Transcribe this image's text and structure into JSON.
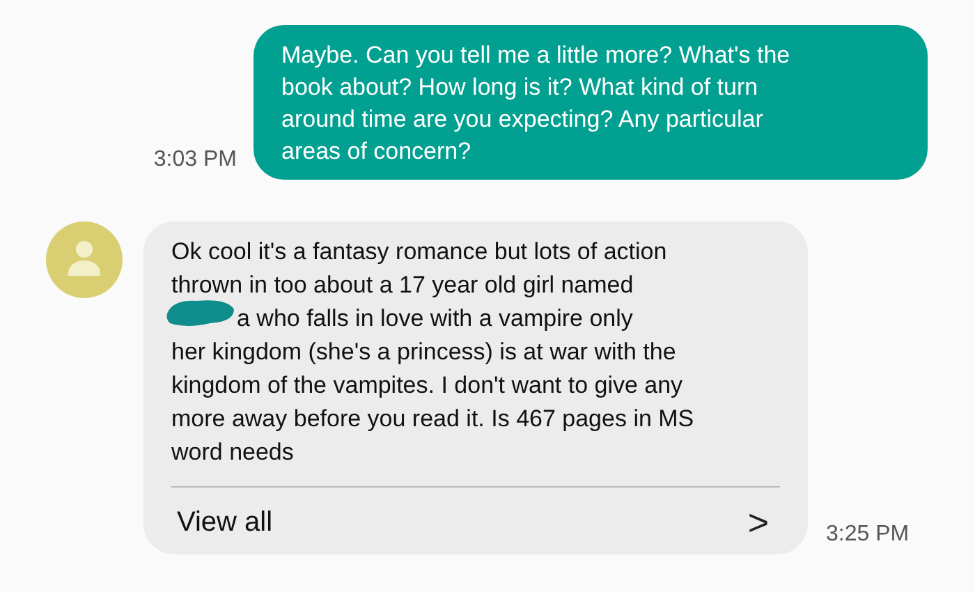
{
  "messages": [
    {
      "kind": "outgoing",
      "lines": [
        "Maybe. Can you tell me a little more? What's the",
        "book about? How long is it? What kind of turn",
        "around time are you expecting? Any particular",
        "areas of concern?"
      ],
      "time": "3:03 PM"
    },
    {
      "kind": "incoming",
      "lines": [
        {
          "text": "Ok cool it's a fantasy romance but lots of action",
          "redacted": false
        },
        {
          "text": "thrown in too about a 17 year old girl named",
          "redacted": false
        },
        {
          "text": "a who falls in love with a vampire only",
          "redacted": true
        },
        {
          "text": "her kingdom (she's a princess) is at war with the",
          "redacted": false
        },
        {
          "text": "kingdom of the vampites. I don't want to give any",
          "redacted": false
        },
        {
          "text": "more away before you read it. Is 467 pages in MS",
          "redacted": false
        },
        {
          "text": "word needs",
          "redacted": false
        }
      ],
      "action": "View all",
      "action_icon": ">",
      "time": "3:25 PM"
    }
  ]
}
